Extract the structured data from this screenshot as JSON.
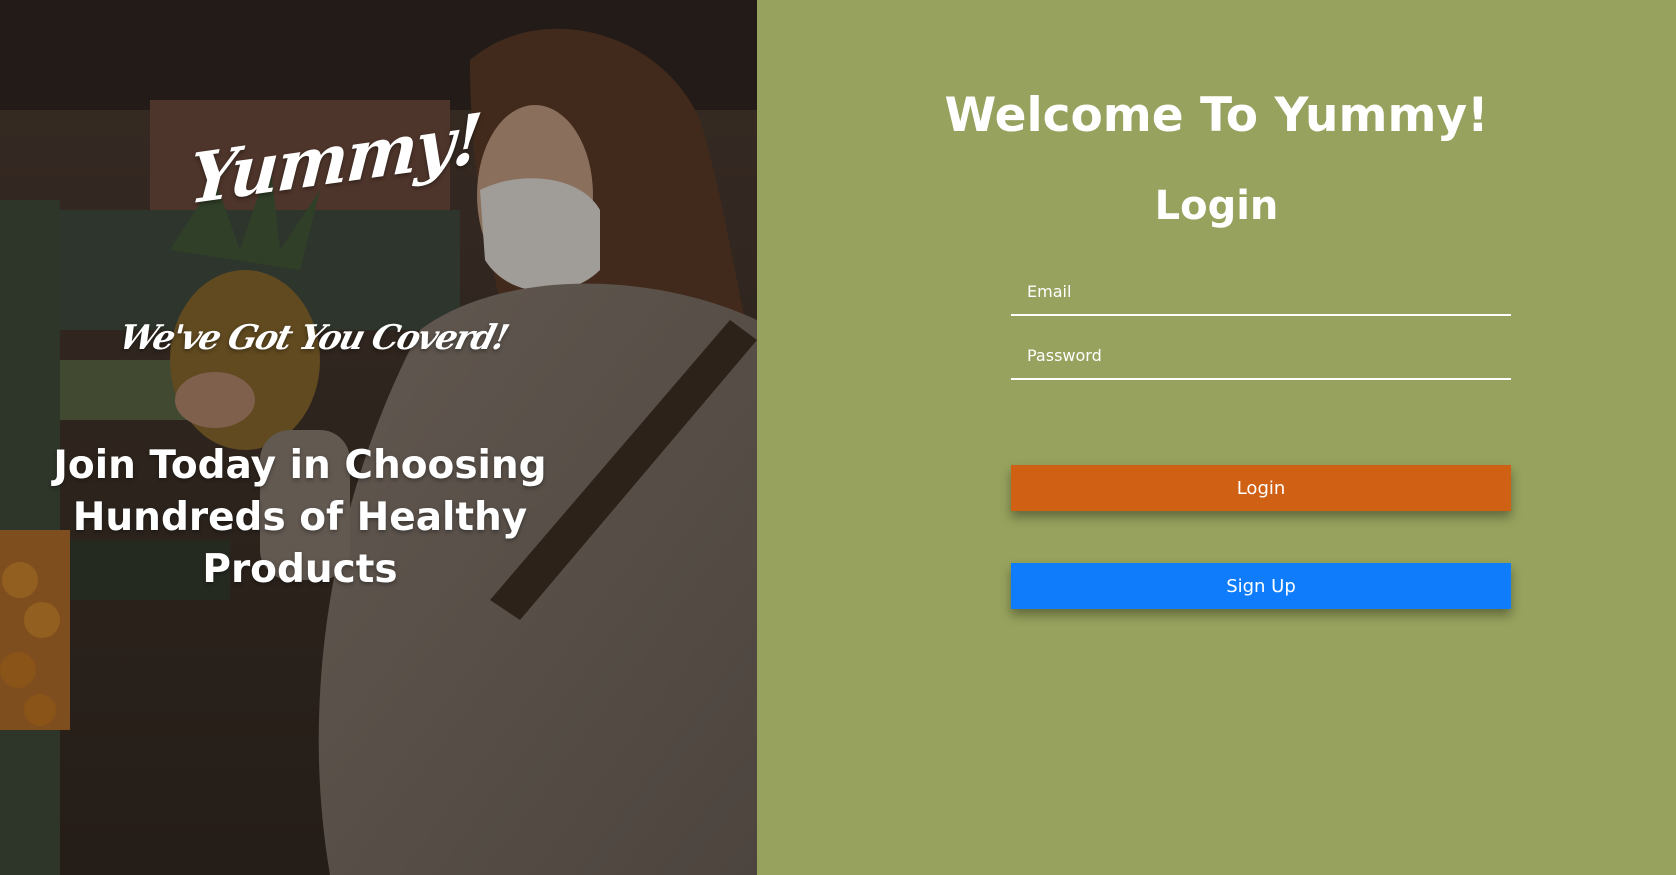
{
  "hero": {
    "logo": "Yummy!",
    "tagline": "We've Got You Coverd!",
    "headline": "Join Today in Choosing Hundreds of Healthy Products",
    "photo": "woman-with-pineapple-grocery-store-photo"
  },
  "form": {
    "welcome_title": "Welcome To Yummy!",
    "heading": "Login",
    "email_placeholder": "Email",
    "password_placeholder": "Password",
    "login_button": "Login",
    "signup_button": "Sign Up"
  },
  "colors": {
    "panel_background": "#96a25d",
    "login_button": "#d06014",
    "signup_button": "#0f7dfb",
    "text": "#ffffff"
  }
}
